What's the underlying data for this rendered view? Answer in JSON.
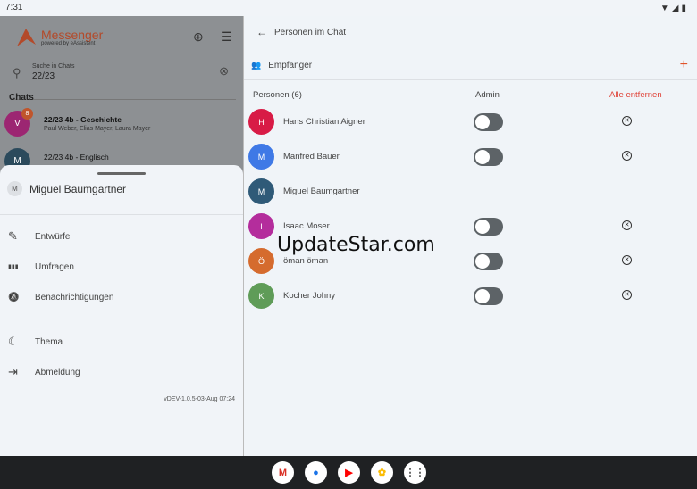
{
  "status": {
    "time": "7:31"
  },
  "sidebar": {
    "app_name": "Messenger",
    "app_sub": "powered by eAssistent",
    "search": {
      "label": "Suche in Chats",
      "value": "22/23"
    },
    "chats_heading": "Chats",
    "chats": [
      {
        "initial": "V",
        "color": "#9c2672",
        "badge": "8",
        "title": "22/23  4b - Geschichte",
        "members": "Paul Weber, Elias Mayer, Laura Mayer"
      },
      {
        "initial": "M",
        "color": "#2b4a5c",
        "title": "22/23  4b - Englisch"
      }
    ]
  },
  "sheet": {
    "user_initial": "M",
    "user_name": "Miguel Baumgartner",
    "menu": [
      {
        "icon": "edit-icon",
        "glyph": "✎",
        "label": "Entwürfe"
      },
      {
        "icon": "chart-icon",
        "glyph": "▮▮▮",
        "label": "Umfragen"
      },
      {
        "icon": "bell-off-icon",
        "glyph": "🔕",
        "label": "Benachrichtigungen"
      },
      {
        "icon": "moon-icon",
        "glyph": "☾",
        "label": "Thema"
      },
      {
        "icon": "logout-icon",
        "glyph": "⇥",
        "label": "Abmeldung"
      }
    ],
    "version": "vDEV-1.0.5-03-Aug 07:24"
  },
  "main": {
    "title": "Personen im Chat",
    "recipients": "Empfänger",
    "col_persons": "Personen (6)",
    "col_admin": "Admin",
    "remove_all": "Alle entfernen",
    "people": [
      {
        "initial": "H",
        "name": "Hans Christian Aigner",
        "color": "#d81b46",
        "admin": false,
        "removable": true
      },
      {
        "initial": "M",
        "name": "Manfred Bauer",
        "color": "#3f79e6",
        "admin": false,
        "removable": true
      },
      {
        "initial": "M",
        "name": "Miguel Baumgartner",
        "color": "#2f5a78",
        "self": true
      },
      {
        "initial": "I",
        "name": "Isaac Moser",
        "color": "#b42d9c",
        "admin": false,
        "removable": true
      },
      {
        "initial": "Ö",
        "name": "öman öman",
        "color": "#d56b2e",
        "admin": false,
        "removable": true
      },
      {
        "initial": "K",
        "name": "Kocher Johny",
        "color": "#5f9c58",
        "admin": false,
        "removable": true
      }
    ]
  },
  "watermark": "UpdateStar.com",
  "taskbar": [
    {
      "name": "gmail",
      "glyph": "M",
      "color": "#d93025"
    },
    {
      "name": "chrome",
      "glyph": "●",
      "color": "#1a73e8"
    },
    {
      "name": "youtube",
      "glyph": "▶",
      "color": "#ff0000"
    },
    {
      "name": "photos",
      "glyph": "✿",
      "color": "#fbbc04"
    },
    {
      "name": "app-drawer",
      "glyph": "⋮⋮",
      "color": "#444"
    }
  ]
}
